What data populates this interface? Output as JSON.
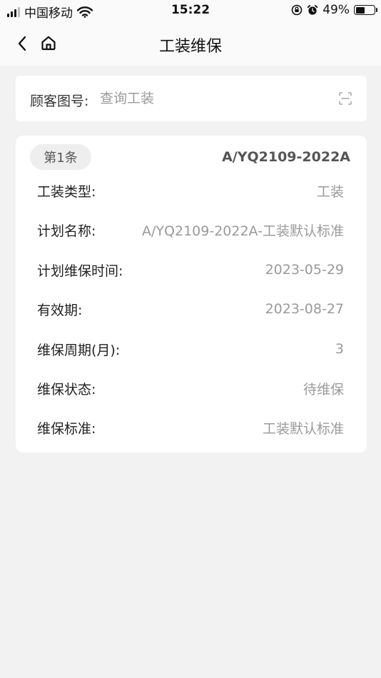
{
  "status_bar": {
    "carrier": "中国移动",
    "time": "15:22",
    "battery_percent": "49%",
    "battery_level": 0.49,
    "icons": [
      "signal-icon",
      "wifi-icon",
      "orientation-lock-icon",
      "alarm-icon",
      "battery-icon"
    ]
  },
  "nav": {
    "title": "工装维保",
    "back_icon": "chevron-left-icon",
    "home_icon": "home-icon"
  },
  "search": {
    "label": "顾客图号:",
    "placeholder": "查询工装",
    "value": "",
    "scan_icon": "scan-icon"
  },
  "record": {
    "index_label": "第1条",
    "code": "A/YQ2109-2022A",
    "fields": [
      {
        "label": "工装类型:",
        "value": "工装"
      },
      {
        "label": "计划名称:",
        "value": "A/YQ2109-2022A-工装默认标准"
      },
      {
        "label": "计划维保时间:",
        "value": "2023-05-29"
      },
      {
        "label": "有效期:",
        "value": "2023-08-27"
      },
      {
        "label": "维保周期(月):",
        "value": "3"
      },
      {
        "label": "维保状态:",
        "value": "待维保"
      },
      {
        "label": "维保标准:",
        "value": "工装默认标准"
      }
    ]
  },
  "colors": {
    "background": "#f2f2f2",
    "card": "#ffffff",
    "value_text": "#9a9a9a",
    "badge_bg": "#eeeeee"
  }
}
